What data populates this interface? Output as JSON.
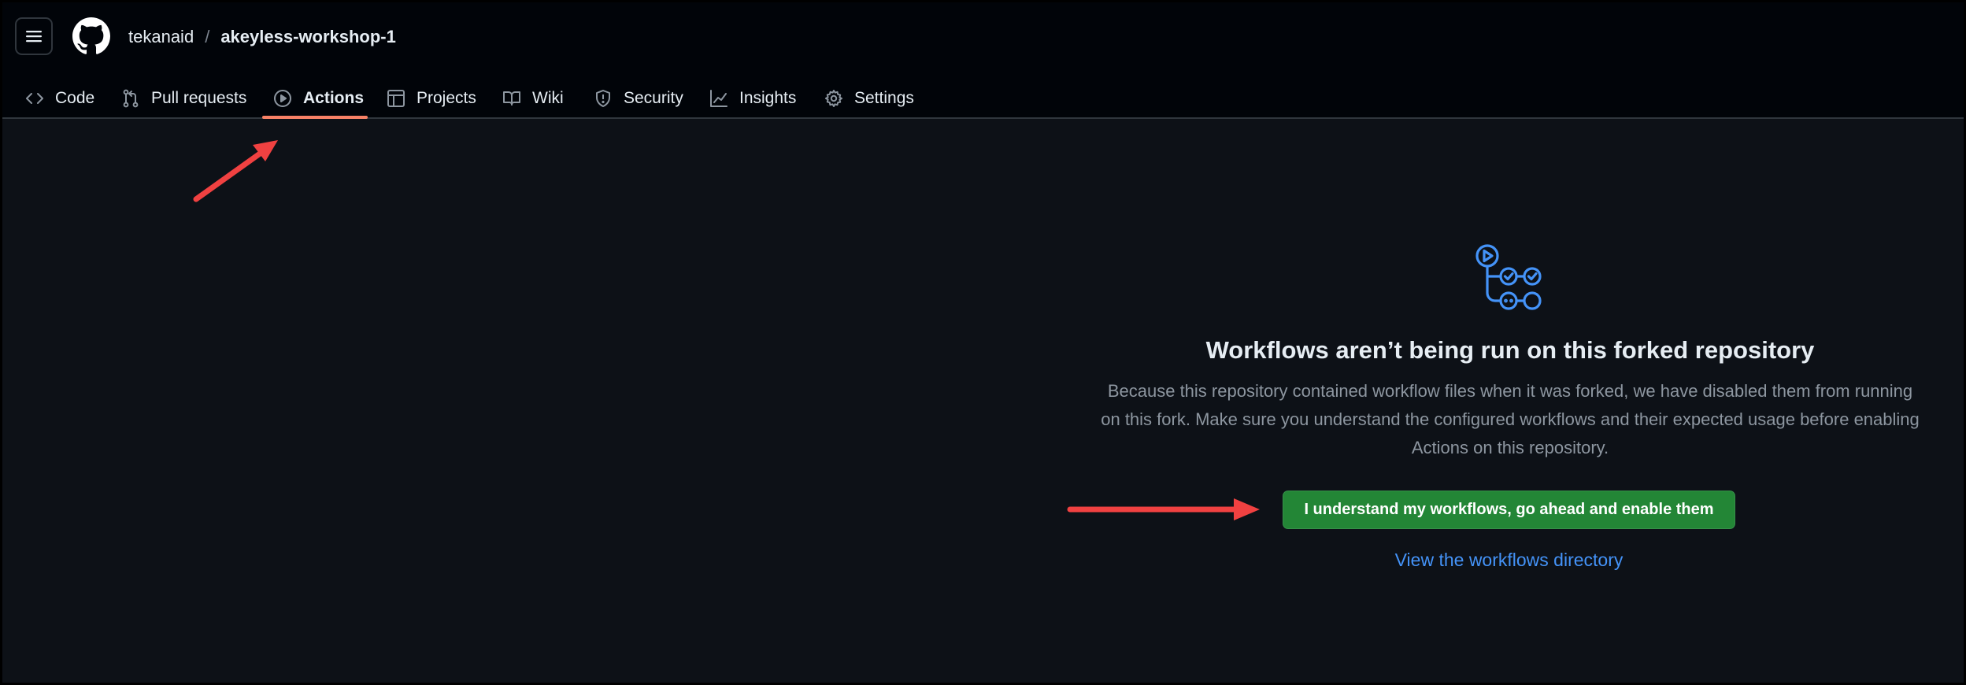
{
  "header": {
    "owner": "tekanaid",
    "separator": "/",
    "repo": "akeyless-workshop-1"
  },
  "tabs": [
    {
      "label": "Code",
      "icon": "code-icon"
    },
    {
      "label": "Pull requests",
      "icon": "git-pull-request-icon"
    },
    {
      "label": "Actions",
      "icon": "play-icon",
      "active": true
    },
    {
      "label": "Projects",
      "icon": "table-icon"
    },
    {
      "label": "Wiki",
      "icon": "book-icon"
    },
    {
      "label": "Security",
      "icon": "shield-icon"
    },
    {
      "label": "Insights",
      "icon": "graph-icon"
    },
    {
      "label": "Settings",
      "icon": "gear-icon"
    }
  ],
  "empty_state": {
    "icon": "workflow-icon",
    "title": "Workflows aren’t being run on this forked repository",
    "description": "Because this repository contained workflow files when it was forked, we have disabled them from running on this fork. Make sure you understand the configured workflows and their expected usage before enabling Actions on this repository.",
    "enable_button": "I understand my workflows, go ahead and enable them",
    "directory_link": "View the workflows directory"
  },
  "colors": {
    "background": "#0d1117",
    "header_background": "#010409",
    "active_tab_underline": "#f78166",
    "primary_button": "#238636",
    "link": "#4493f8",
    "workflow_icon": "#4493f8",
    "annotation_arrow": "#f04141"
  }
}
